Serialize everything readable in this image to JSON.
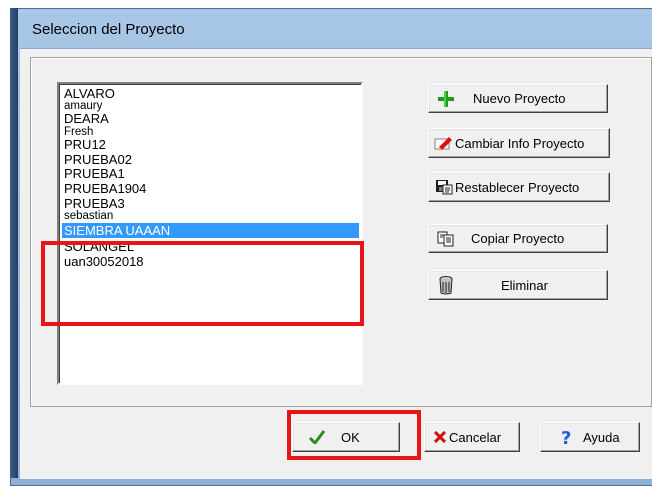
{
  "window": {
    "title": "Seleccion del Proyecto"
  },
  "projects": {
    "items": [
      "ALVARO",
      "amaury",
      "DEARA",
      "Fresh",
      "PRU12",
      "PRUEBA02",
      "PRUEBA1",
      "PRUEBA1904",
      "PRUEBA3",
      "sebastian",
      "SIEMBRA UAAAN",
      "SOLANGEL",
      "uan30052018"
    ],
    "selected": "SIEMBRA UAAAN"
  },
  "actions": {
    "new_project": "Nuevo Proyecto",
    "change_info": "Cambiar Info Proyecto",
    "restore_project": "Restablecer Proyecto",
    "copy_project": "Copiar Proyecto",
    "delete": "Eliminar"
  },
  "footer": {
    "ok": "OK",
    "cancel": "Cancelar",
    "help": "Ayuda"
  },
  "colors": {
    "selection": "#3399ff",
    "highlight_box": "#e81416",
    "title_bar": "#9bbbdc"
  },
  "icons": {
    "new_project": "plus-icon",
    "change_info": "edit-pencil-icon",
    "restore_project": "floppy-disk-icon",
    "copy_project": "copy-icon",
    "delete": "trash-icon",
    "ok": "checkmark-icon",
    "cancel": "x-icon",
    "help": "question-icon"
  }
}
